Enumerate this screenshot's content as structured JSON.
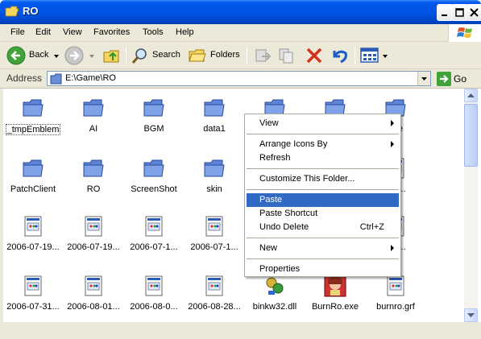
{
  "window": {
    "title": "RO"
  },
  "menubar": {
    "items": [
      "File",
      "Edit",
      "View",
      "Favorites",
      "Tools",
      "Help"
    ]
  },
  "toolbar": {
    "back_label": "Back",
    "search_label": "Search",
    "folders_label": "Folders"
  },
  "address": {
    "label": "Address",
    "value": "E:\\Game\\RO",
    "go_label": "Go"
  },
  "files": [
    {
      "name": "_tmpEmblem",
      "icon": "folder-icon"
    },
    {
      "name": "AI",
      "icon": "folder-icon"
    },
    {
      "name": "BGM",
      "icon": "folder-icon"
    },
    {
      "name": "data1",
      "icon": "folder-icon"
    },
    {
      "name": "",
      "icon": "folder-icon"
    },
    {
      "name": "",
      "icon": "folder-icon"
    },
    {
      "name": "ube",
      "icon": "folder-icon"
    },
    {
      "name": "PatchClient",
      "icon": "folder-icon"
    },
    {
      "name": "RO",
      "icon": "folder-icon"
    },
    {
      "name": "ScreenShot",
      "icon": "folder-icon"
    },
    {
      "name": "skin",
      "icon": "folder-icon"
    },
    {
      "name": "-13...",
      "icon": "image-file-icon"
    },
    {
      "name": "2006-07-19...",
      "icon": "image-file-icon"
    },
    {
      "name": "2006-07-19...",
      "icon": "image-file-icon"
    },
    {
      "name": "2006-07-1...",
      "icon": "image-file-icon"
    },
    {
      "name": "2006-07-1...",
      "icon": "image-file-icon"
    },
    {
      "name": "-31...",
      "icon": "image-file-icon"
    },
    {
      "name": "2006-07-31...",
      "icon": "image-file-icon"
    },
    {
      "name": "2006-08-01...",
      "icon": "image-file-icon"
    },
    {
      "name": "2006-08-0...",
      "icon": "image-file-icon"
    },
    {
      "name": "2006-08-28...",
      "icon": "image-file-icon"
    },
    {
      "name": "binkw32.dll",
      "icon": "dll-file-icon"
    },
    {
      "name": "BurnRo.exe",
      "icon": "exe-file-icon"
    },
    {
      "name": "burnro.grf",
      "icon": "image-file-icon"
    }
  ],
  "context_menu": {
    "view": "View",
    "arrange": "Arrange Icons By",
    "refresh": "Refresh",
    "customize": "Customize This Folder...",
    "paste": "Paste",
    "paste_shortcut": "Paste Shortcut",
    "undo_delete": "Undo Delete",
    "undo_shortcut": "Ctrl+Z",
    "new": "New",
    "properties": "Properties"
  },
  "colors": {
    "titlebar": "#0055e5",
    "highlight": "#316ac5",
    "chrome": "#ece9d8"
  }
}
